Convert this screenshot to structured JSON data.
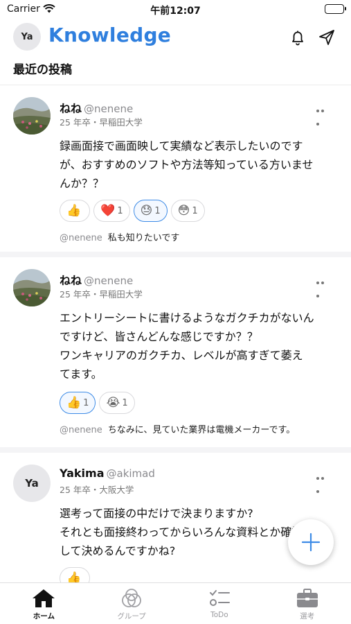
{
  "status_bar": {
    "carrier": "Carrier",
    "time": "午前12:07"
  },
  "header": {
    "avatar_text": "Ya",
    "title": "Knowledge"
  },
  "section_title": "最近の投稿",
  "posts": [
    {
      "name": "ねね",
      "handle": "@nenene",
      "meta": "25 年卒・早稲田大学",
      "body": [
        "録画面接で画面映して実績など表示したいのです",
        "が、おすすめのソフトや方法等知っている方いませ",
        "んか？？"
      ],
      "reactions": [
        {
          "emoji": "👍",
          "count": "",
          "active": false
        },
        {
          "emoji": "❤️",
          "count": "1",
          "active": false
        },
        {
          "emoji": "😓",
          "count": "1",
          "active": true
        },
        {
          "emoji": "😳",
          "count": "1",
          "active": false
        }
      ],
      "comment_handle": "@nenene",
      "comment_text": "私も知りたいです"
    },
    {
      "name": "ねね",
      "handle": "@nenene",
      "meta": "25 年卒・早稲田大学",
      "body": [
        "エントリーシートに書けるようなガクチカがないん",
        "ですけど、皆さんどんな感じですか？？",
        "ワンキャリアのガクチカ、レベルが高すぎて萎え",
        "てます。"
      ],
      "reactions": [
        {
          "emoji": "👍",
          "count": "1",
          "active": true
        },
        {
          "emoji": "😭",
          "count": "1",
          "active": false
        }
      ],
      "comment_handle": "@nenene",
      "comment_text": "ちなみに、見ていた業界は電機メーカーです。"
    },
    {
      "name": "Yakima",
      "handle": "@akimad",
      "avatar_text": "Ya",
      "meta": "25 年卒・大阪大学",
      "body": [
        "選考って面接の中だけで決まりますか?",
        "それとも面接終わってからいろんな資料とか確認も",
        "して決めるんですかね?"
      ],
      "reactions": [
        {
          "emoji": "👍",
          "count": "",
          "active": false
        }
      ]
    }
  ],
  "tabs": [
    {
      "label": "ホーム",
      "icon": "home-icon",
      "active": true
    },
    {
      "label": "グループ",
      "icon": "group-icon",
      "active": false
    },
    {
      "label": "ToDo",
      "icon": "todo-icon",
      "active": false
    },
    {
      "label": "選考",
      "icon": "briefcase-icon",
      "active": false
    }
  ],
  "colors": {
    "accent": "#2f7fde",
    "reaction_active_border": "#3d8be6"
  }
}
